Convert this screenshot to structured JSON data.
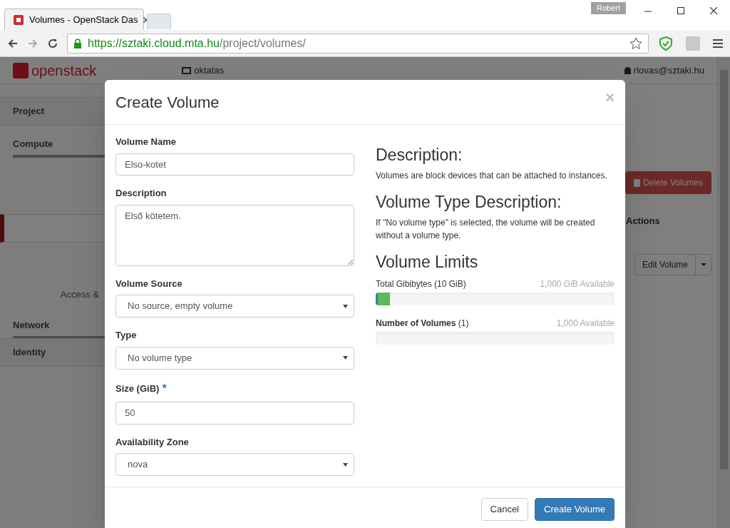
{
  "browser": {
    "user": "Robert",
    "tabs": [
      {
        "title": "Volumes - OpenStack Das",
        "selected": true
      },
      {
        "selected": false
      }
    ],
    "url_host": "https://sztaki.cloud.mta.hu",
    "url_path": "/project/volumes/"
  },
  "header": {
    "logo": "openstack",
    "project": "oktatas",
    "user": "rlovas@sztaki.hu"
  },
  "sidebar": {
    "items": [
      {
        "label": "Project",
        "kind": "panel"
      },
      {
        "label": "Compute",
        "kind": "section"
      },
      {
        "kind": "active"
      },
      {
        "label": "Access &",
        "kind": "link"
      },
      {
        "label": "Network",
        "kind": "section"
      },
      {
        "label": "Identity",
        "kind": "panel"
      }
    ]
  },
  "page": {
    "delete_button": "Delete Volumes",
    "actions_heading": "Actions",
    "edit_button": "Edit Volume"
  },
  "modal": {
    "title": "Create Volume",
    "close": "×",
    "fields": [
      {
        "label": "Volume Name",
        "kind": "text",
        "value": "Elso-kotet"
      },
      {
        "label": "Description",
        "kind": "textarea",
        "value": "Első kötetem."
      },
      {
        "label": "Volume Source",
        "kind": "select",
        "value": "No source, empty volume"
      },
      {
        "label": "Type",
        "kind": "select",
        "value": "No volume type"
      },
      {
        "label": "Size (GiB)",
        "kind": "text",
        "value": "50",
        "required_mark": "*"
      },
      {
        "label": "Availability Zone",
        "kind": "select",
        "value": "nova"
      }
    ],
    "help": [
      {
        "heading": "Description:",
        "text": "Volumes are block devices that can be attached to instances."
      },
      {
        "heading": "Volume Type Description:",
        "text": "If \"No volume type\" is selected, the volume will be created without a volume type."
      }
    ],
    "limits_heading": "Volume Limits",
    "limits": [
      {
        "label": "Total Gibibytes (10 GiB)",
        "available": "1,000 GiB Available",
        "segments": [
          {
            "kind": "used",
            "level": 0.01
          },
          {
            "kind": "requested",
            "level": 0.05
          }
        ]
      },
      {
        "label": "**Number of Volumes** (1)",
        "available": "1,000 Available"
      }
    ],
    "buttons": [
      {
        "label": "Cancel",
        "kind": "default"
      },
      {
        "label": "Create Volume",
        "kind": "primary"
      }
    ]
  }
}
